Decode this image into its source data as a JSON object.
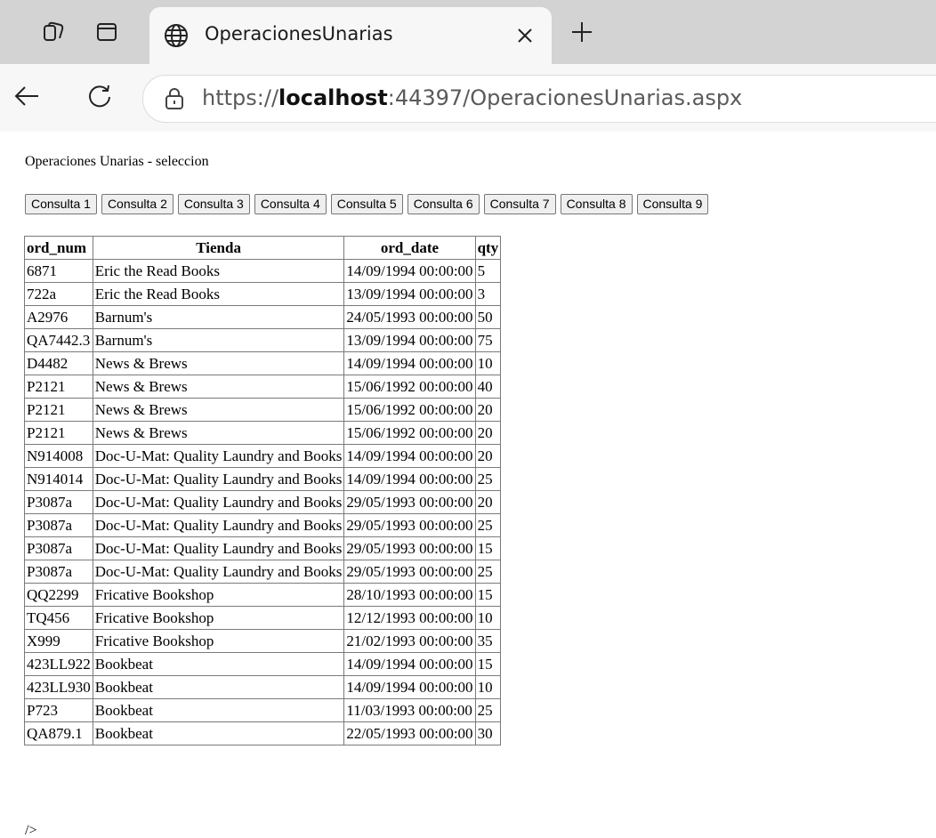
{
  "browser": {
    "tab_title": "OperacionesUnarias",
    "url_scheme": "https://",
    "url_host": "localhost",
    "url_rest": ":44397/OperacionesUnarias.aspx"
  },
  "page": {
    "heading": "Operaciones Unarias - seleccion",
    "buttons": [
      "Consulta 1",
      "Consulta 2",
      "Consulta 3",
      "Consulta 4",
      "Consulta 5",
      "Consulta 6",
      "Consulta 7",
      "Consulta 8",
      "Consulta 9"
    ],
    "table": {
      "headers": [
        "ord_num",
        "Tienda",
        "ord_date",
        "qty"
      ],
      "rows": [
        [
          "6871",
          "Eric the Read Books",
          "14/09/1994 00:00:00",
          "5"
        ],
        [
          "722a",
          "Eric the Read Books",
          "13/09/1994 00:00:00",
          "3"
        ],
        [
          "A2976",
          "Barnum's",
          "24/05/1993 00:00:00",
          "50"
        ],
        [
          "QA7442.3",
          "Barnum's",
          "13/09/1994 00:00:00",
          "75"
        ],
        [
          "D4482",
          "News & Brews",
          "14/09/1994 00:00:00",
          "10"
        ],
        [
          "P2121",
          "News & Brews",
          "15/06/1992 00:00:00",
          "40"
        ],
        [
          "P2121",
          "News & Brews",
          "15/06/1992 00:00:00",
          "20"
        ],
        [
          "P2121",
          "News & Brews",
          "15/06/1992 00:00:00",
          "20"
        ],
        [
          "N914008",
          "Doc-U-Mat: Quality Laundry and Books",
          "14/09/1994 00:00:00",
          "20"
        ],
        [
          "N914014",
          "Doc-U-Mat: Quality Laundry and Books",
          "14/09/1994 00:00:00",
          "25"
        ],
        [
          "P3087a",
          "Doc-U-Mat: Quality Laundry and Books",
          "29/05/1993 00:00:00",
          "20"
        ],
        [
          "P3087a",
          "Doc-U-Mat: Quality Laundry and Books",
          "29/05/1993 00:00:00",
          "25"
        ],
        [
          "P3087a",
          "Doc-U-Mat: Quality Laundry and Books",
          "29/05/1993 00:00:00",
          "15"
        ],
        [
          "P3087a",
          "Doc-U-Mat: Quality Laundry and Books",
          "29/05/1993 00:00:00",
          "25"
        ],
        [
          "QQ2299",
          "Fricative Bookshop",
          "28/10/1993 00:00:00",
          "15"
        ],
        [
          "TQ456",
          "Fricative Bookshop",
          "12/12/1993 00:00:00",
          "10"
        ],
        [
          "X999",
          "Fricative Bookshop",
          "21/02/1993 00:00:00",
          "35"
        ],
        [
          "423LL922",
          "Bookbeat",
          "14/09/1994 00:00:00",
          "15"
        ],
        [
          "423LL930",
          "Bookbeat",
          "14/09/1994 00:00:00",
          "10"
        ],
        [
          "P723",
          "Bookbeat",
          "11/03/1993 00:00:00",
          "25"
        ],
        [
          "QA879.1",
          "Bookbeat",
          "22/05/1993 00:00:00",
          "30"
        ]
      ]
    },
    "trailing_text": "/>"
  }
}
